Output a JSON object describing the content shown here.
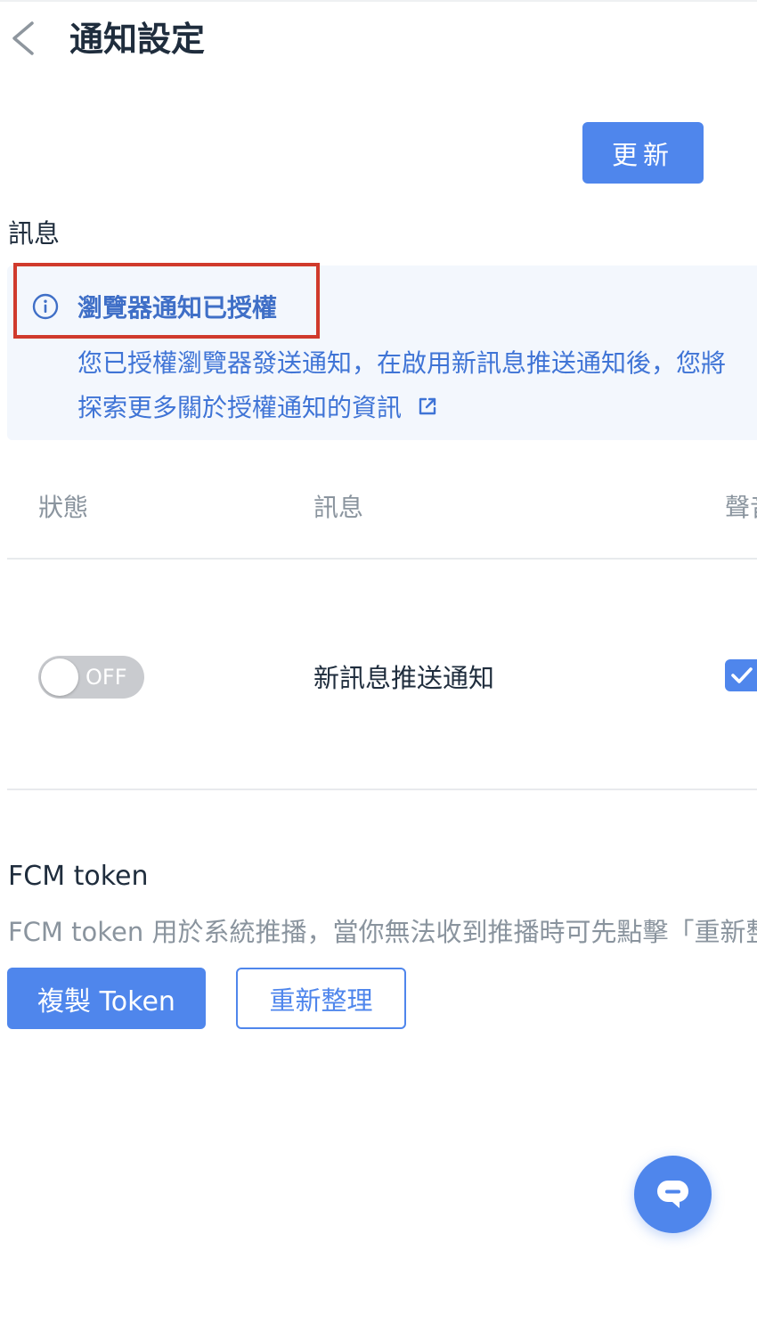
{
  "header": {
    "title": "通知設定",
    "back_icon": "chevron-left-icon"
  },
  "actions": {
    "update_label": "更新"
  },
  "messages_section": {
    "label": "訊息"
  },
  "alert": {
    "icon": "info-icon",
    "title": "瀏覽器通知已授權",
    "body": "您已授權瀏覽器發送通知，在啟用新訊息推送通知後，您將",
    "link_text": "探索更多關於授權通知的資訊",
    "link_icon": "external-link-icon",
    "color": "#3f74d6",
    "background": "#f3f7fd"
  },
  "table": {
    "columns": [
      "狀態",
      "訊息",
      "聲音"
    ],
    "rows": [
      {
        "status_toggle": {
          "state": "off",
          "label": "OFF"
        },
        "message": "新訊息推送通知",
        "sound_checked": true
      }
    ]
  },
  "fcm": {
    "title": "FCM token",
    "description": "FCM token 用於系統推播，當你無法收到推播時可先點擊「重新整理」",
    "copy_label": "複製 Token",
    "refresh_label": "重新整理"
  },
  "chat": {
    "icon": "chat-icon"
  },
  "colors": {
    "primary": "#4f86ec",
    "highlight_border": "#d03a2c",
    "text_dark": "#1f2d3d",
    "text_muted": "#8a949e"
  }
}
